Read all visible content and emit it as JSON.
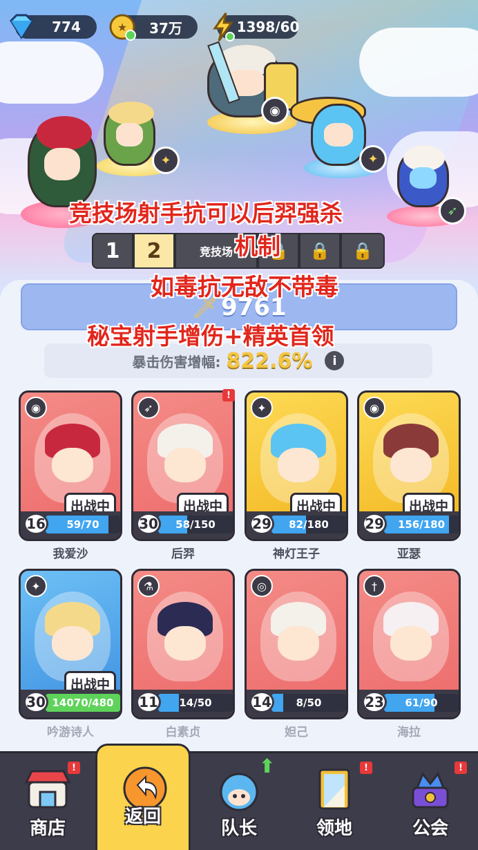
{
  "resources": {
    "gems": "774",
    "gold": "37万",
    "energy": "1398/60"
  },
  "captions": {
    "line1": "竞技场射手抗可以后羿强杀",
    "line2": "机制",
    "line3": "如毒抗无敌不带毒",
    "line4": "秘宝射手增伤+精英首领"
  },
  "arena": {
    "tier_tabs": [
      "1",
      "2"
    ],
    "arena_label": "竞技场",
    "power": "9761",
    "crit_label": "暴击伤害增幅:",
    "crit_value": "822.6%"
  },
  "heroes": [
    {
      "name": "我爱沙",
      "level": "16",
      "shards": "59/70",
      "progress": 0.84,
      "in_battle": true,
      "color": "red",
      "class_icon": "rabbit-icon"
    },
    {
      "name": "后羿",
      "level": "30",
      "shards": "58/150",
      "progress": 0.39,
      "in_battle": true,
      "color": "red",
      "class_icon": "bow-icon",
      "alert": true
    },
    {
      "name": "神灯王子",
      "level": "29",
      "shards": "82/180",
      "progress": 0.46,
      "in_battle": true,
      "color": "yellow",
      "class_icon": "wings-icon"
    },
    {
      "name": "亚瑟",
      "level": "29",
      "shards": "156/180",
      "progress": 0.87,
      "in_battle": true,
      "color": "yellow",
      "class_icon": "rabbit-icon"
    },
    {
      "name": "吟游诗人",
      "level": "30",
      "shards": "14070/480",
      "progress": 1.0,
      "in_battle": true,
      "color": "blue",
      "class_icon": "wings-icon"
    },
    {
      "name": "白素贞",
      "level": "11",
      "shards": "14/50",
      "progress": 0.28,
      "in_battle": false,
      "color": "red",
      "class_icon": "potion-icon"
    },
    {
      "name": "妲己",
      "level": "14",
      "shards": "8/50",
      "progress": 0.16,
      "in_battle": false,
      "color": "red",
      "class_icon": "swirl-icon"
    },
    {
      "name": "海拉",
      "level": "23",
      "shards": "61/90",
      "progress": 0.68,
      "in_battle": false,
      "color": "red",
      "class_icon": "dagger-icon"
    }
  ],
  "in_battle_label": "出战中",
  "nav": [
    {
      "label": "商店",
      "icon": "shop-icon",
      "alert": true
    },
    {
      "label": "返回",
      "icon": "back-arrow-icon",
      "active": true
    },
    {
      "label": "队长",
      "icon": "captain-icon",
      "upgrade": true
    },
    {
      "label": "领地",
      "icon": "territory-door-icon",
      "alert": true
    },
    {
      "label": "公会",
      "icon": "guild-icon",
      "alert": true
    }
  ],
  "colors": {
    "card_red": "#ec6a6a",
    "card_yellow": "#f2b51f",
    "card_blue": "#3c8fe0",
    "caption_red": "#e1261c",
    "nav_bg": "#3d3c4a",
    "nav_active": "#fbd34c"
  }
}
